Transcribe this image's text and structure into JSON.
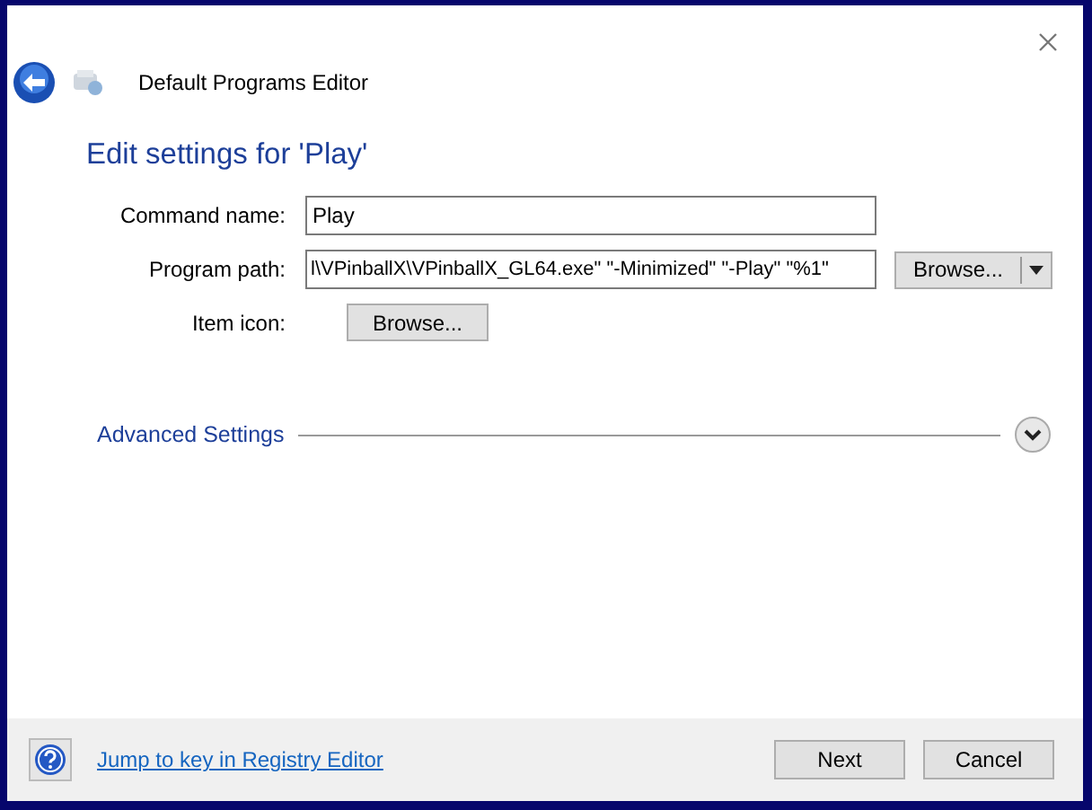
{
  "window": {
    "title": "Default Programs Editor"
  },
  "heading": "Edit settings for 'Play'",
  "fields": [
    {
      "kind": "text",
      "label": "Command name:",
      "value": "Play"
    },
    {
      "kind": "path",
      "label": "Program path:",
      "value": "l\\VPinballX\\VPinballX_GL64.exe\" \"-Minimized\" \"-Play\" \"%1\"",
      "button": "Browse..."
    },
    {
      "kind": "button",
      "label": "Item icon:",
      "button": "Browse..."
    }
  ],
  "advanced": {
    "label": "Advanced Settings",
    "expanded": false
  },
  "footer": {
    "link": "Jump to key in Registry Editor",
    "buttons": [
      "Next",
      "Cancel"
    ]
  }
}
